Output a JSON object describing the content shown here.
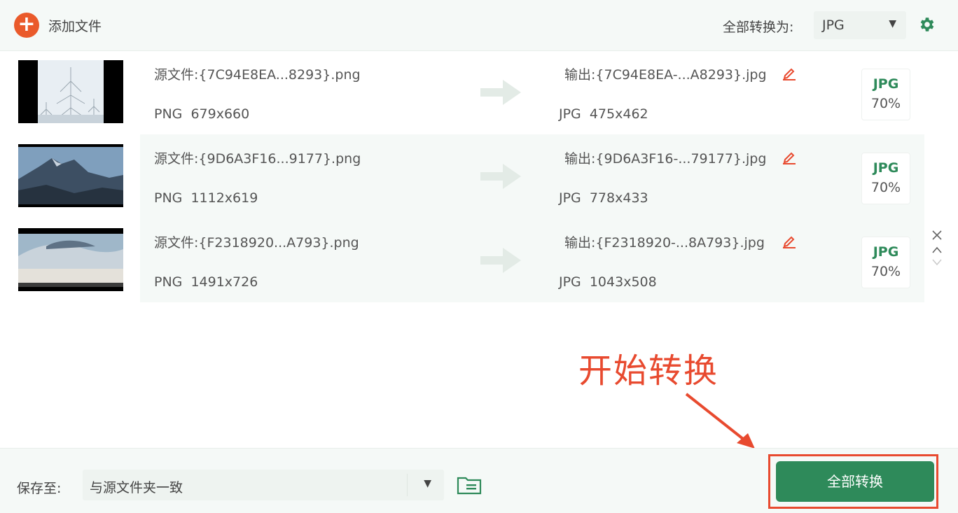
{
  "toolbar": {
    "add_files_label": "添加文件",
    "convert_all_to_label": "全部转换为:",
    "format_selected": "JPG"
  },
  "files": [
    {
      "source_name": "源文件:{7C94E8EA...8293}.png",
      "source_format": "PNG",
      "source_dims": "679x660",
      "output_name": "输出:{7C94E8EA-...A8293}.jpg",
      "output_format": "JPG",
      "output_dims": "475x462",
      "badge_format": "JPG",
      "badge_quality": "70%"
    },
    {
      "source_name": "源文件:{9D6A3F16...9177}.png",
      "source_format": "PNG",
      "source_dims": "1112x619",
      "output_name": "输出:{9D6A3F16-...79177}.jpg",
      "output_format": "JPG",
      "output_dims": "778x433",
      "badge_format": "JPG",
      "badge_quality": "70%"
    },
    {
      "source_name": "源文件:{F2318920...A793}.png",
      "source_format": "PNG",
      "source_dims": "1491x726",
      "output_name": "输出:{F2318920-...8A793}.jpg",
      "output_format": "JPG",
      "output_dims": "1043x508",
      "badge_format": "JPG",
      "badge_quality": "70%"
    }
  ],
  "annotation": {
    "text": "开始转换"
  },
  "footer": {
    "save_to_label": "保存至:",
    "save_to_value": "与源文件夹一致",
    "convert_all_button": "全部转换"
  },
  "colors": {
    "accent_green": "#2e8a5a",
    "add_orange": "#ea5a2b",
    "annotation_red": "#e84a2f"
  }
}
